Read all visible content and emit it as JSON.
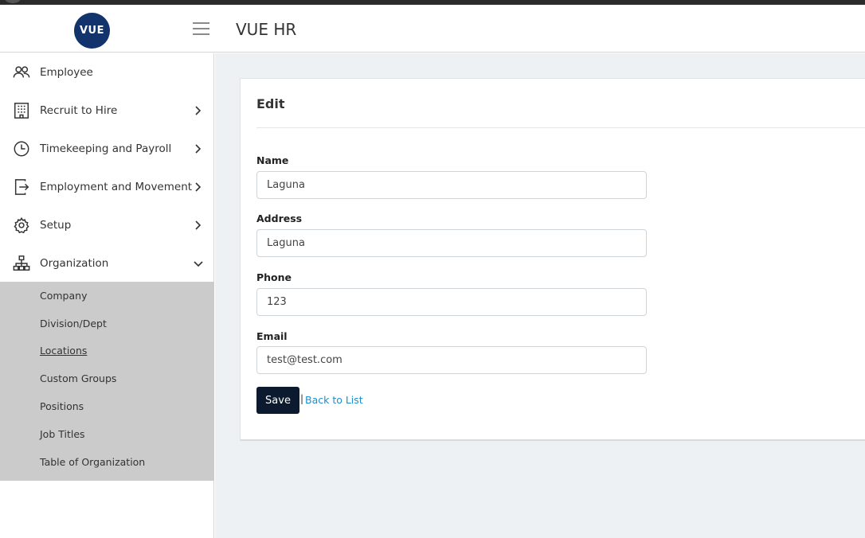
{
  "header": {
    "logo_text": "VUE",
    "app_title": "VUE HR"
  },
  "sidebar": {
    "items": [
      {
        "label": "Employee",
        "icon": "users-icon",
        "has_chevron": false
      },
      {
        "label": "Recruit to Hire",
        "icon": "building-icon",
        "chevron": "chevron-right-icon"
      },
      {
        "label": "Timekeeping and Payroll",
        "icon": "clock-icon",
        "chevron": "chevron-right-icon"
      },
      {
        "label": "Employment and Movement",
        "icon": "exit-icon",
        "chevron": "chevron-right-icon"
      },
      {
        "label": "Setup",
        "icon": "gear-icon",
        "chevron": "chevron-right-icon"
      },
      {
        "label": "Organization",
        "icon": "org-chart-icon",
        "chevron": "chevron-down-icon"
      }
    ],
    "submenu": [
      {
        "label": "Company"
      },
      {
        "label": "Division/Dept"
      },
      {
        "label": "Locations",
        "active": true
      },
      {
        "label": "Custom Groups"
      },
      {
        "label": "Positions"
      },
      {
        "label": "Job Titles"
      },
      {
        "label": "Table of Organization"
      }
    ]
  },
  "form": {
    "title": "Edit",
    "fields": [
      {
        "label": "Name",
        "value": "Laguna"
      },
      {
        "label": "Address",
        "value": "Laguna"
      },
      {
        "label": "Phone",
        "value": "123"
      },
      {
        "label": "Email",
        "value": "test@test.com"
      }
    ],
    "save_label": "Save",
    "separator": "|",
    "back_label": "Back to List"
  },
  "colors": {
    "logo_bg": "#12336b",
    "submenu_bg": "#cbcbcb",
    "main_bg": "#eef1f4",
    "save_bg": "#0b1a2e",
    "link": "#1a8fd0"
  }
}
